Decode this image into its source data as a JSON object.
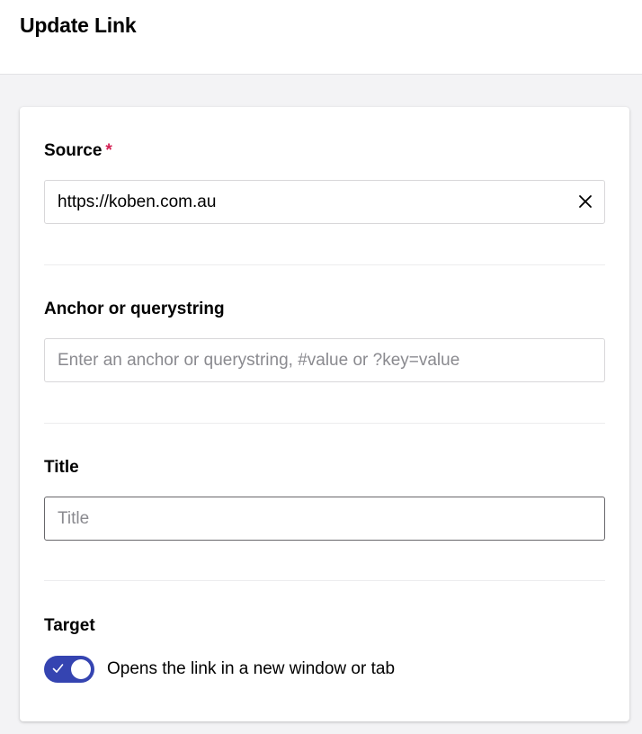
{
  "header": {
    "title": "Update Link"
  },
  "form": {
    "source": {
      "label": "Source",
      "required_mark": "*",
      "value": "https://koben.com.au"
    },
    "anchor": {
      "label": "Anchor or querystring",
      "value": "",
      "placeholder": "Enter an anchor or querystring, #value or ?key=value"
    },
    "title": {
      "label": "Title",
      "value": "",
      "placeholder": "Title"
    },
    "target": {
      "label": "Target",
      "toggle_text": "Opens the link in a new window or tab",
      "enabled": true
    }
  },
  "colors": {
    "toggle_on": "#3544b1",
    "required": "#d42054"
  },
  "icons": {
    "clear": "close-icon",
    "toggle_check": "check-icon"
  }
}
